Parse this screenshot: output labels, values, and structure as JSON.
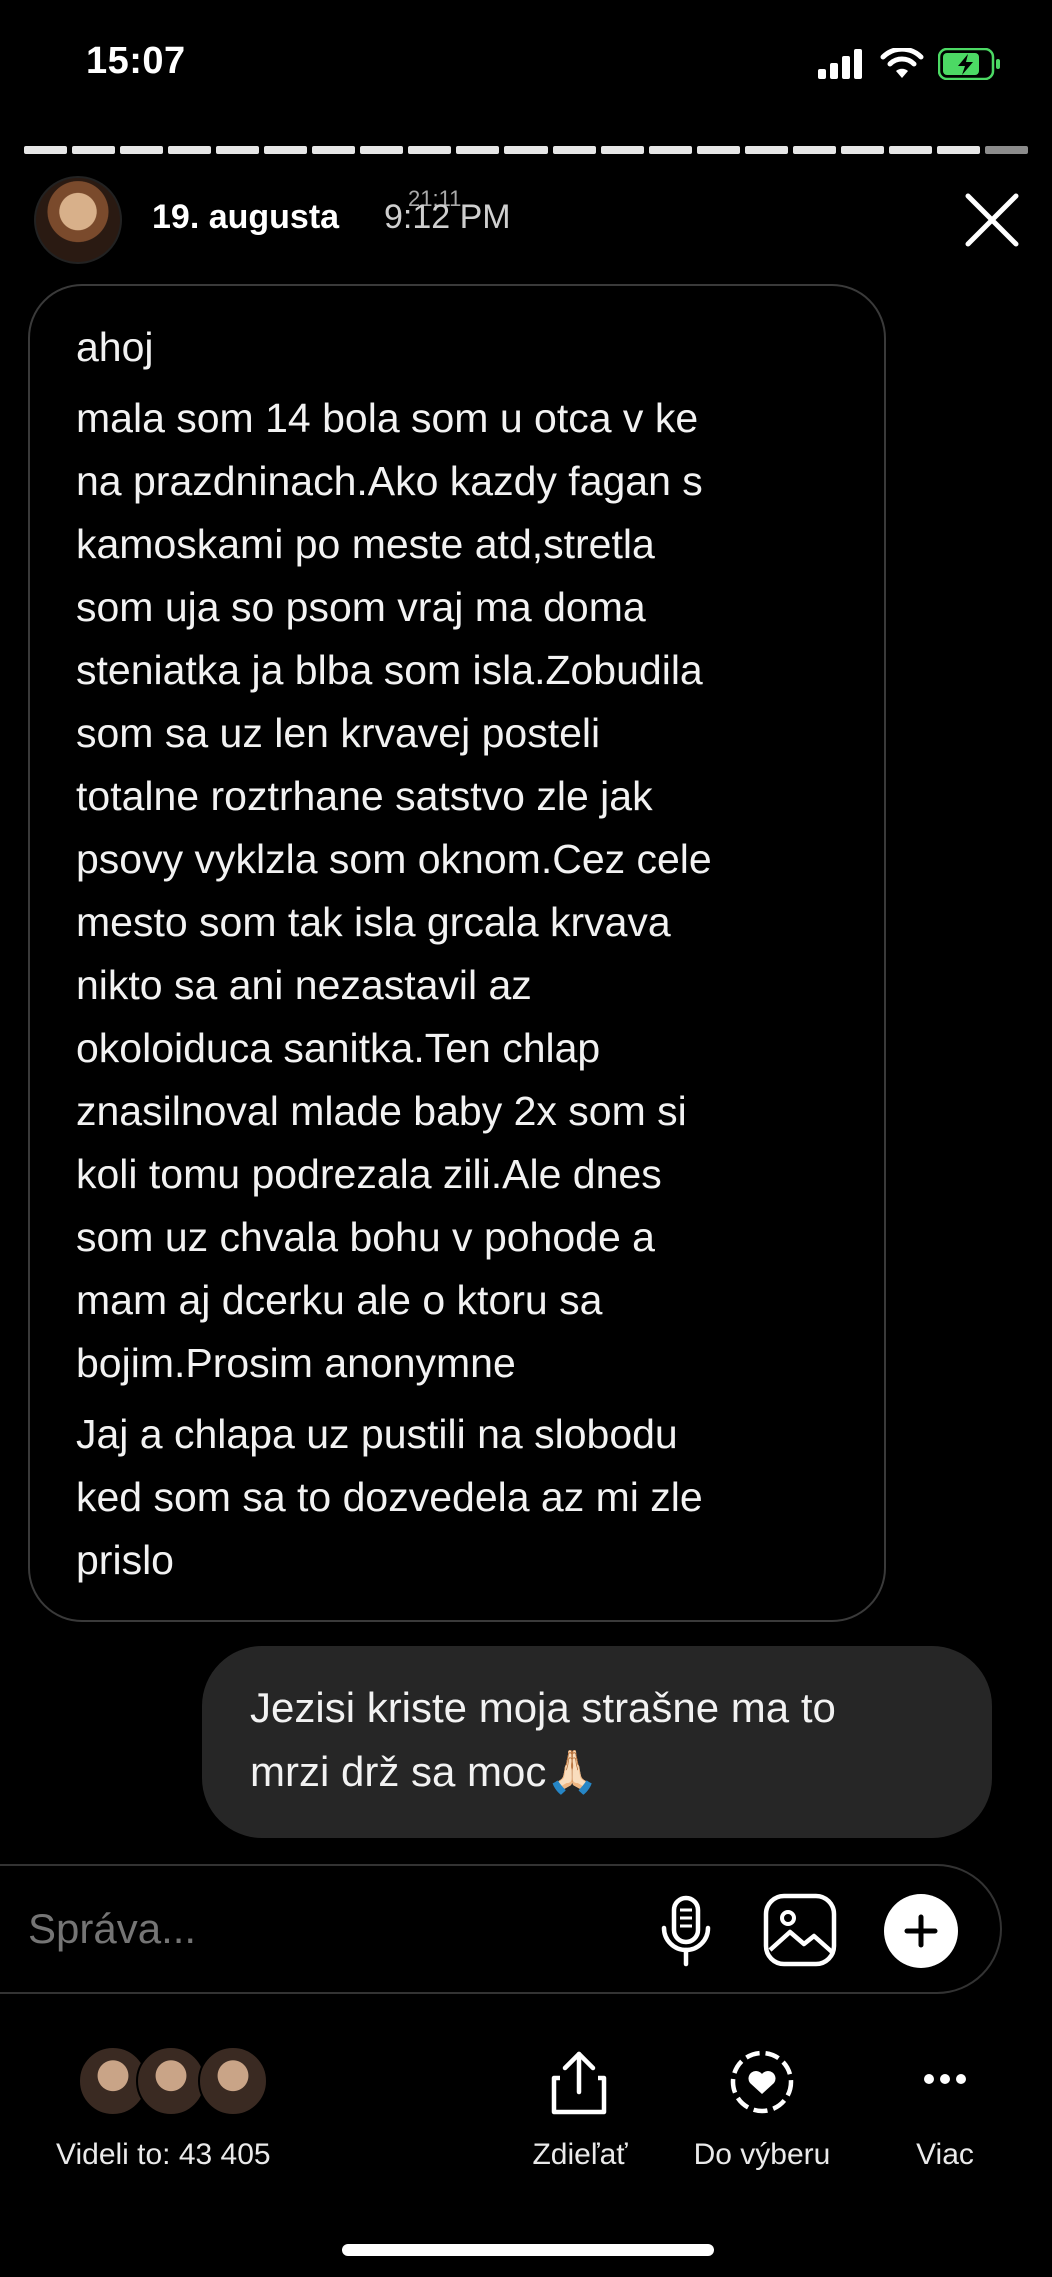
{
  "status_bar": {
    "time": "15:07"
  },
  "header": {
    "user": "19. augusta",
    "time": "9:12 PM",
    "time_overlay": "21:11"
  },
  "messages": {
    "incoming_lines": [
      "ahoj",
      "mala som 14 bola som u otca v ke",
      "na prazdninach.Ako kazdy fagan s",
      "kamoskami po meste atd,stretla",
      "som uja so psom vraj ma doma",
      "steniatka ja blba som isla.Zobudila",
      "som sa uz len krvavej posteli",
      "totalne roztrhane satstvo zle jak",
      "psovy vyklzla som oknom.Cez cele",
      "mesto som tak isla grcala krvava",
      "nikto sa ani nezastavil az",
      "okoloiduca sanitka.Ten chlap",
      "znasilnoval mlade baby 2x som si",
      "koli tomu podrezala zili.Ale dnes",
      "som uz chvala bohu v pohode a",
      "mam aj dcerku ale o ktoru sa",
      "bojim.Prosim anonymne",
      "Jaj a chlapa uz pustili na slobodu",
      "ked som sa to dozvedela az mi zle",
      "prislo"
    ],
    "outgoing_lines": [
      "Jezisi kriste moja strašne ma to",
      "mrzi drž sa moc🙏🏻"
    ]
  },
  "composer": {
    "placeholder": "Správa..."
  },
  "bottom_bar": {
    "viewers_label": "Videli to: 43 405",
    "share_label": "Zdieľať",
    "highlight_label": "Do výberu",
    "more_label": "Viac"
  },
  "icons": [
    "signal-icon",
    "wifi-icon",
    "battery-icon",
    "close-icon",
    "mic-icon",
    "image-icon",
    "plus-icon",
    "share-icon",
    "highlight-icon",
    "more-icon"
  ],
  "colors": {
    "background": "#000000",
    "outgoing_bubble": "#262626",
    "battery": "#4cd964"
  }
}
